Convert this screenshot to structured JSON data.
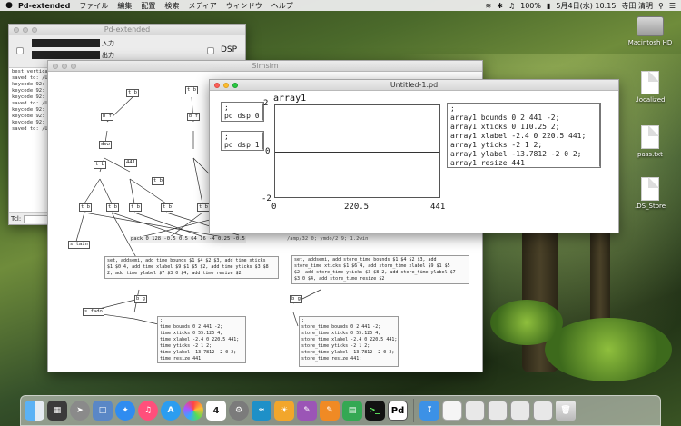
{
  "menubar": {
    "apple": "",
    "app": "Pd-extended",
    "menus": [
      "ファイル",
      "編集",
      "配置",
      "検索",
      "メディア",
      "ウィンドウ",
      "ヘルプ"
    ],
    "battery": "100%",
    "datetime": "5月4日(水)  10:15",
    "user": "寺田 清明"
  },
  "desktop": {
    "icons": [
      {
        "label": "Macintosh HD"
      },
      {
        "label": ".localized"
      },
      {
        "label": "pass.txt"
      },
      {
        "label": ".DS_Store"
      }
    ]
  },
  "pd_main": {
    "title": "Pd-extended",
    "input_label": "入力",
    "output_label": "出力",
    "dsp_label": "DSP",
    "console_lines": [
      "best vertical dis",
      "saved to: /User",
      "keycode 92: dro",
      "keycode 92: dro",
      "keycode 92: dro",
      "saved to: /User",
      "keycode 92: dro",
      "keycode 92: dro",
      "keycode 92: dro",
      "saved to: /User"
    ],
    "tcl_label": "Tcl:"
  },
  "simsim": {
    "title": "Simsim",
    "objects": [
      "t b",
      "t b",
      "b f",
      "b f",
      "dsw",
      "441",
      "t b",
      "t b",
      "t b",
      "t b",
      "t b",
      "t b",
      "t b",
      "t b",
      "s tain",
      "b g",
      "b g",
      "s fado"
    ],
    "status_text": "pack 0 128 -0.5 0.5 64 16 -4 0.25 -0.5",
    "status_text2": "/amp/32 0; ymdo/2 9; 1.2win",
    "msg1": "set, addsemi, add time bounds $1 $4 $2 $3, add time xticks\n$1 $0 4, add time xlabel $9 $1 $5 $2, add time yticks $3 $8\n2, add time ylabel $7 $3 0 $4, add time resize $2",
    "msg2": "set, addsemi, add store_time bounds $1 $4 $2 $3, add\nstore_time xticks $1 $6 4, add store_time xlabel $9 $1 $5\n$2, add store_time yticks $3 $8 2, add store_time ylabel $7\n$3 0 $4, add store_time resize $2",
    "msg3": ";\ntime bounds 0 2 441 -2;\ntime xticks 0 55.125 4;\ntime xlabel -2.4 0 220.5 441;\ntime yticks -2 1 2;\ntime ylabel -13.7812 -2 0 2;\ntime resize 441;",
    "msg4": ";\nstore_time bounds 0 2 441 -2;\nstore_time xticks 0 55.125 4;\nstore_time xlabel -2.4 0 220.5 441;\nstore_time yticks -2 1 2;\nstore_time ylabel -13.7812 -2 0 2;\nstore_time resize 441;"
  },
  "untitled": {
    "title": "Untitled-1.pd",
    "array_name": "array1",
    "dsp_on_msg": ";\npd dsp 1",
    "dsp_off_msg": ";\npd dsp 0",
    "config_msg": ";\narray1 bounds 0 2 441 -2;\narray1 xticks 0 110.25 2;\narray1 xlabel -2.4 0 220.5 441;\narray1 yticks -2 1 2;\narray1 ylabel -13.7812 -2 0 2;\narray1 resize 441",
    "y_labels": [
      "2",
      "0",
      "-2"
    ],
    "x_labels": [
      "0",
      "220.5",
      "441"
    ]
  },
  "dock": {
    "items": [
      "Finder",
      "Launchpad",
      "Safari",
      "Preview",
      "Safari",
      "iTunes",
      "App Store",
      "Photos",
      "Calendar",
      "System Preferences",
      "Max",
      "Scratch",
      "Sketchbook",
      "Pages",
      "Numbers",
      "Terminal",
      "Pd",
      "Downloads",
      "Document",
      "Window",
      "Window",
      "Window",
      "Window",
      "Trash"
    ],
    "calendar_date": "4"
  },
  "colors": {
    "window_red": "#fc5f57",
    "window_yellow": "#fdbc2e",
    "window_green": "#28c840"
  }
}
